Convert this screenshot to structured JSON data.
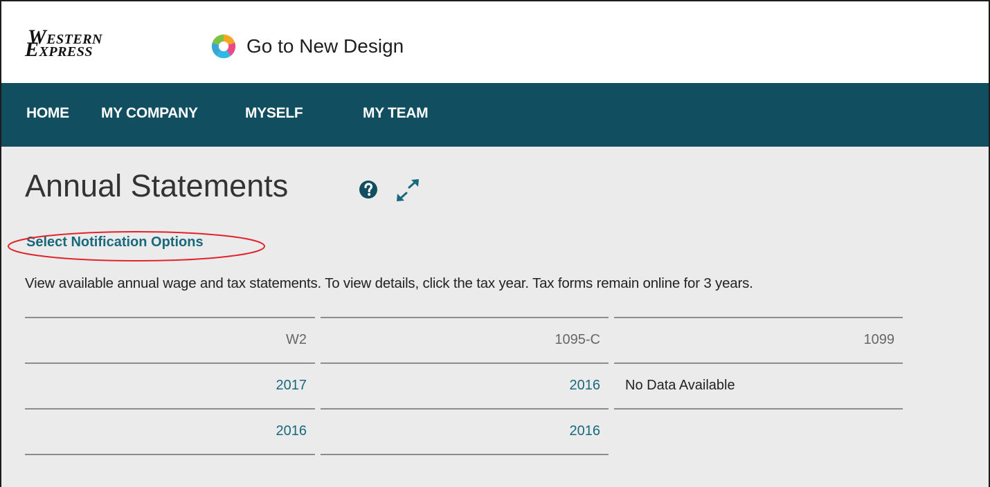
{
  "brand": {
    "logo_top": "WESTERN",
    "logo_bottom": "EXPRESS",
    "new_design_label": "Go to New Design"
  },
  "nav": {
    "items": [
      {
        "label": "HOME"
      },
      {
        "label": "MY COMPANY"
      },
      {
        "label": "MYSELF"
      },
      {
        "label": "MY TEAM"
      }
    ]
  },
  "page": {
    "title": "Annual Statements",
    "notification_link": "Select Notification Options",
    "description": "View available annual wage and tax statements. To view details, click the tax year. Tax forms remain online for 3 years."
  },
  "table": {
    "columns": [
      {
        "header": "W2",
        "rows": [
          "2017",
          "2016"
        ]
      },
      {
        "header": "1095-C",
        "rows": [
          "2016",
          "2016"
        ]
      },
      {
        "header": "1099",
        "rows": [
          "No Data Available"
        ]
      }
    ]
  },
  "icons": {
    "help": "help-circle-icon",
    "expand": "expand-arrows-icon"
  },
  "colors": {
    "nav_background": "#114f60",
    "link": "#17697c",
    "content_background": "#ebebeb",
    "highlight_ellipse": "#e2222b"
  }
}
